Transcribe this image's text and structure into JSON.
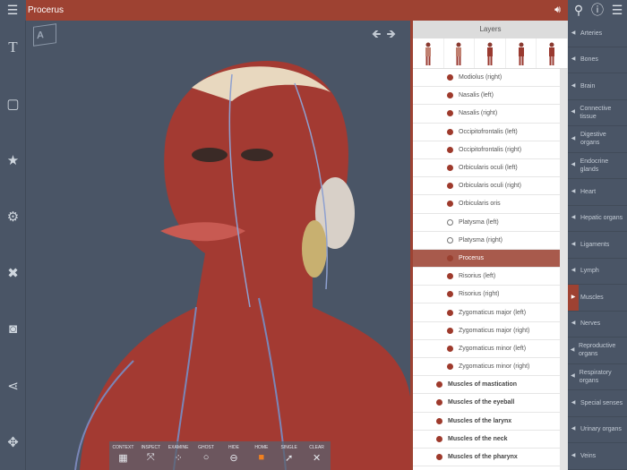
{
  "title": "Procerus",
  "layers_title": "Layers",
  "toolbar": [
    {
      "label": "CONTEXT",
      "icon": "▦"
    },
    {
      "label": "INSPECT",
      "icon": "⤧"
    },
    {
      "label": "EXAMINE",
      "icon": "⁘"
    },
    {
      "label": "GHOST",
      "icon": "○"
    },
    {
      "label": "HIDE",
      "icon": "⊖"
    },
    {
      "label": "HOME",
      "icon": "■"
    },
    {
      "label": "SINGLE",
      "icon": "➚"
    },
    {
      "label": "CLEAR",
      "icon": "✕"
    }
  ],
  "layers": [
    {
      "label": "Modiolus (right)",
      "state": "on"
    },
    {
      "label": "Nasalis (left)",
      "state": "on"
    },
    {
      "label": "Nasalis (right)",
      "state": "on"
    },
    {
      "label": "Occipitofrontalis (left)",
      "state": "on"
    },
    {
      "label": "Occipitofrontalis (right)",
      "state": "on"
    },
    {
      "label": "Orbicularis oculi (left)",
      "state": "on"
    },
    {
      "label": "Orbicularis oculi (right)",
      "state": "on"
    },
    {
      "label": "Orbicularis oris",
      "state": "on"
    },
    {
      "label": "Platysma (left)",
      "state": "off"
    },
    {
      "label": "Platysma (right)",
      "state": "off"
    },
    {
      "label": "Procerus",
      "state": "selected"
    },
    {
      "label": "Risorius (left)",
      "state": "on"
    },
    {
      "label": "Risorius (right)",
      "state": "on"
    },
    {
      "label": "Zygomaticus major (left)",
      "state": "on"
    },
    {
      "label": "Zygomaticus major (right)",
      "state": "on"
    },
    {
      "label": "Zygomaticus minor (left)",
      "state": "on"
    },
    {
      "label": "Zygomaticus minor (right)",
      "state": "on"
    }
  ],
  "groups": [
    "Muscles of mastication",
    "Muscles of the eyeball",
    "Muscles of the larynx",
    "Muscles of the neck",
    "Muscles of the pharynx"
  ],
  "systems": [
    "Arteries",
    "Bones",
    "Brain",
    "Connective tissue",
    "Digestive organs",
    "Endocrine glands",
    "Heart",
    "Hepatic organs",
    "Ligaments",
    "Lymph",
    "Muscles",
    "Nerves",
    "Reproductive organs",
    "Respiratory organs",
    "Special senses",
    "Urinary organs",
    "Veins"
  ],
  "active_system": "Muscles",
  "cube_label": "A",
  "colors": {
    "accent": "#9e4232",
    "bg": "#4a5566"
  }
}
